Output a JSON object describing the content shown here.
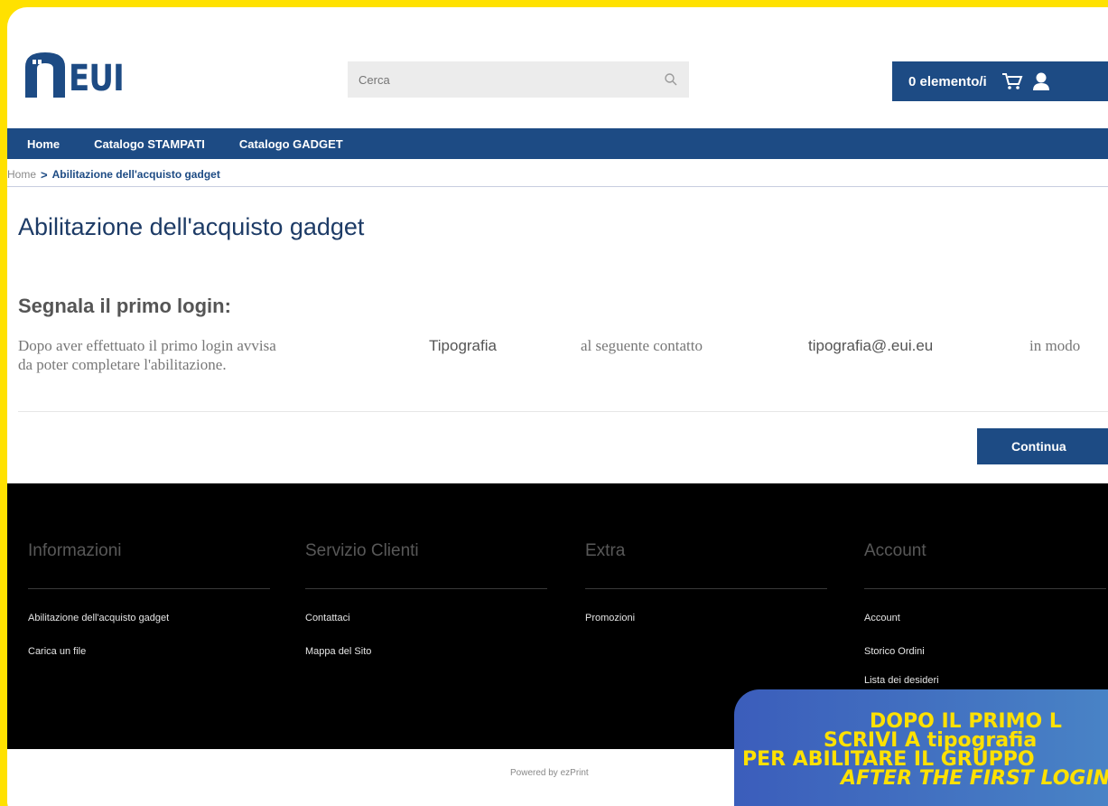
{
  "header": {
    "logo_text": "EUI",
    "search_placeholder": "Cerca",
    "cart_count": "0 elemento/i"
  },
  "nav": {
    "items": [
      "Home",
      "Catalogo STAMPATI",
      "Catalogo GADGET"
    ]
  },
  "breadcrumb": {
    "home": "Home",
    "separator": ">",
    "current": "Abilitazione dell'acquisto gadget"
  },
  "main": {
    "title": "Abilitazione dell'acquisto gadget",
    "section_title": "Segnala il primo login:",
    "para_1": "Dopo aver effettuato il primo login avvisa",
    "para_name": "Tipografia",
    "para_2": "al seguente contatto",
    "para_email": "tipografia@.eui.eu",
    "para_3": "in modo",
    "para_4": "da poter completare l'abilitazione.",
    "continue_label": "Continua"
  },
  "footer": {
    "columns": [
      {
        "title": "Informazioni",
        "links": [
          "Abilitazione dell'acquisto gadget",
          "Carica un file"
        ]
      },
      {
        "title": "Servizio Clienti",
        "links": [
          "Contattaci",
          "Mappa del Sito"
        ]
      },
      {
        "title": "Extra",
        "links": [
          "Promozioni"
        ]
      },
      {
        "title": "Account",
        "links": [
          "Account",
          "Storico Ordini",
          "Lista dei desideri"
        ]
      }
    ],
    "powered_by": "Powered by ezPrint"
  },
  "callout": {
    "line1": "DOPO IL PRIMO L",
    "line2": "SCRIVI A tipografia",
    "line3": "PER ABILITARE IL GRUPPO",
    "line4": "AFTER THE FIRST LOGIN"
  },
  "colors": {
    "brand_blue": "#1d4b84",
    "frame_yellow": "#FFE100",
    "footer_black": "#000000"
  }
}
